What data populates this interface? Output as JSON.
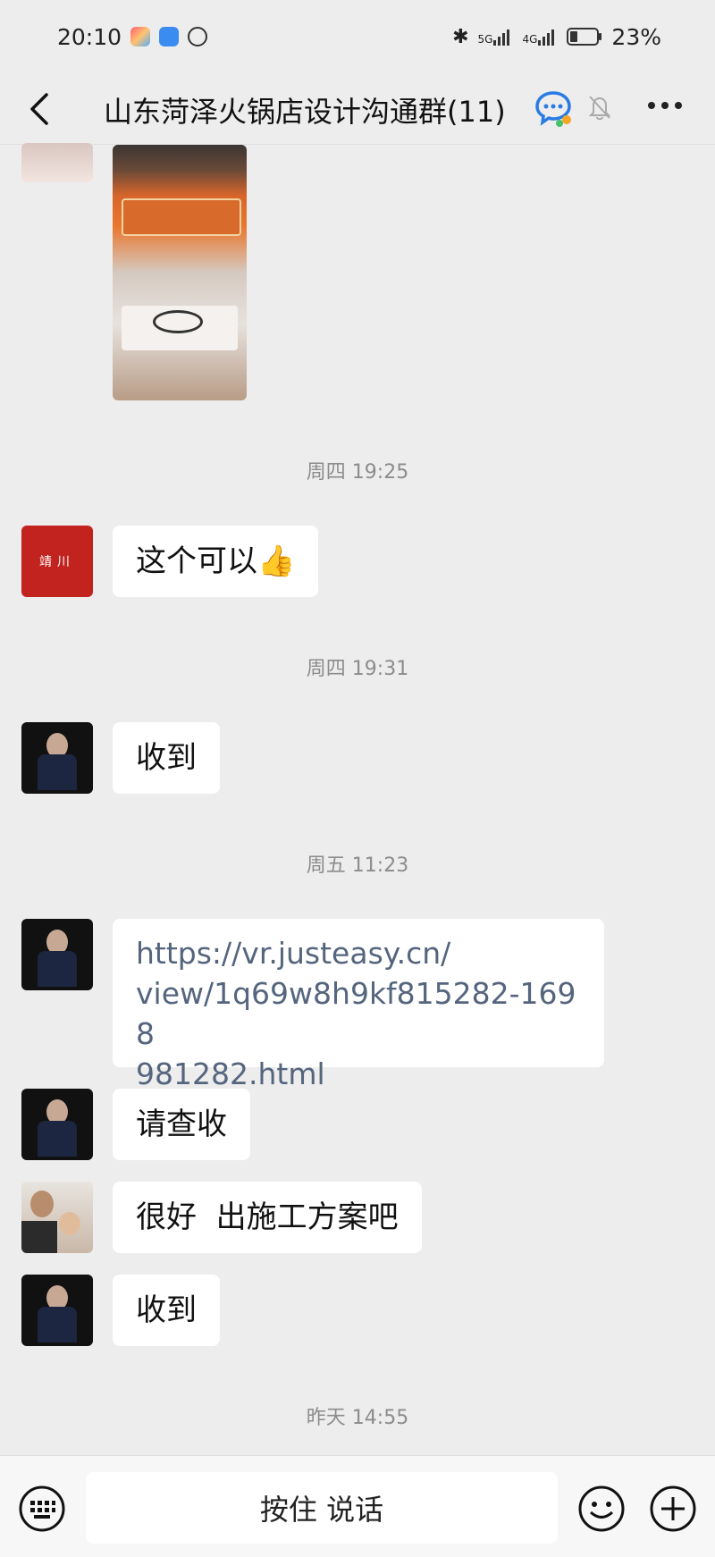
{
  "status_bar": {
    "time": "20:10",
    "sig1": "5G",
    "sig2": "4G",
    "battery": "23%"
  },
  "header": {
    "title": "山东菏泽火锅店设计沟通群(11)"
  },
  "messages": {
    "time1": "周四 19:25",
    "msg1": "这个可以👍",
    "avatar1_text": "靖川",
    "time2": "周四 19:31",
    "msg2": "收到",
    "time3": "周五 11:23",
    "msg3_line1": "https://vr.justeasy.cn/",
    "msg3_line2": "view/1q69w8h9kf815282-1698",
    "msg3_line3": "981282.html",
    "msg4": "请查收",
    "msg5": "很好  出施工方案吧",
    "msg6": "收到",
    "time4": "昨天 14:55"
  },
  "input_bar": {
    "voice_label": "按住 说话"
  },
  "colors": {
    "background": "#ededed",
    "bubble": "#ffffff",
    "link": "#55657e",
    "time": "#8c8c8c"
  }
}
